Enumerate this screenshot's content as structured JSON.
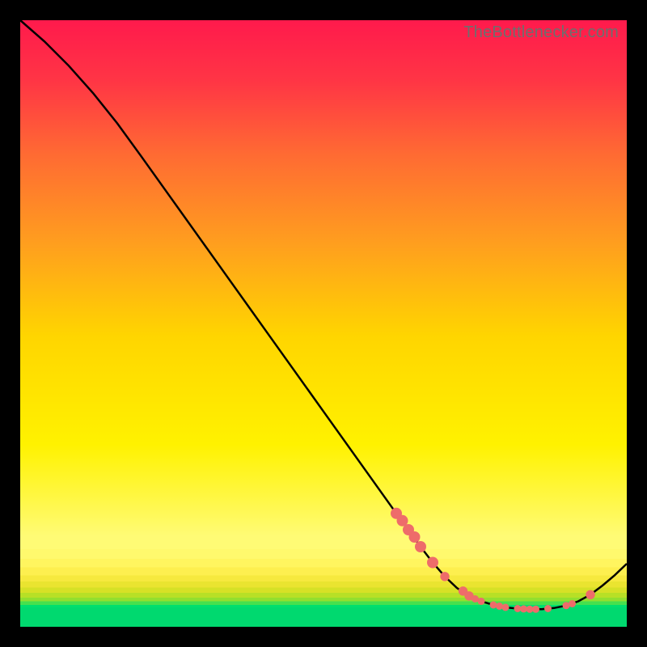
{
  "watermark": "TheBottlenecker.com",
  "colors": {
    "red": "#ff1a4c",
    "orange": "#ff8c24",
    "yellow": "#ffff00",
    "green": "#00d96f",
    "line": "#000000",
    "dot": "#ee6c6a",
    "background": "#000000"
  },
  "chart_data": {
    "type": "line",
    "title": "",
    "xlabel": "",
    "ylabel": "",
    "xlim": [
      0,
      100
    ],
    "ylim": [
      0,
      100
    ],
    "x": [
      0,
      4,
      8,
      12,
      16,
      20,
      25,
      30,
      35,
      40,
      45,
      50,
      55,
      60,
      62,
      64,
      66,
      68,
      70,
      72,
      74,
      76,
      78,
      80,
      82,
      84,
      86,
      88,
      90,
      92,
      94,
      96,
      98,
      100
    ],
    "y": [
      100,
      96.5,
      92.5,
      88,
      83,
      77.5,
      70.5,
      63.5,
      56.5,
      49.5,
      42.5,
      35.5,
      28.5,
      21.5,
      18.7,
      16.0,
      13.2,
      10.6,
      8.3,
      6.4,
      5.1,
      4.2,
      3.6,
      3.2,
      3.0,
      2.9,
      2.9,
      3.1,
      3.5,
      4.2,
      5.3,
      6.8,
      8.5,
      10.4
    ],
    "note": "x and y are in percent of plot width/height; curve starts at top-left, descends steeply, bottoms out near x≈85, then rises slightly toward the right edge.",
    "dots_x": [
      62,
      63,
      64,
      65,
      66,
      68,
      70,
      73,
      74,
      75,
      76,
      78,
      79,
      80,
      82,
      83,
      84,
      85,
      87,
      90,
      91,
      94
    ],
    "dots_y": [
      18.7,
      17.5,
      16.0,
      14.8,
      13.2,
      10.6,
      8.3,
      5.9,
      5.1,
      4.6,
      4.2,
      3.6,
      3.4,
      3.2,
      3.0,
      2.95,
      2.9,
      2.9,
      3.0,
      3.5,
      3.8,
      5.3
    ],
    "dots_note": "scatter points lie on the curve in the lower-right region; radii slightly vary"
  }
}
